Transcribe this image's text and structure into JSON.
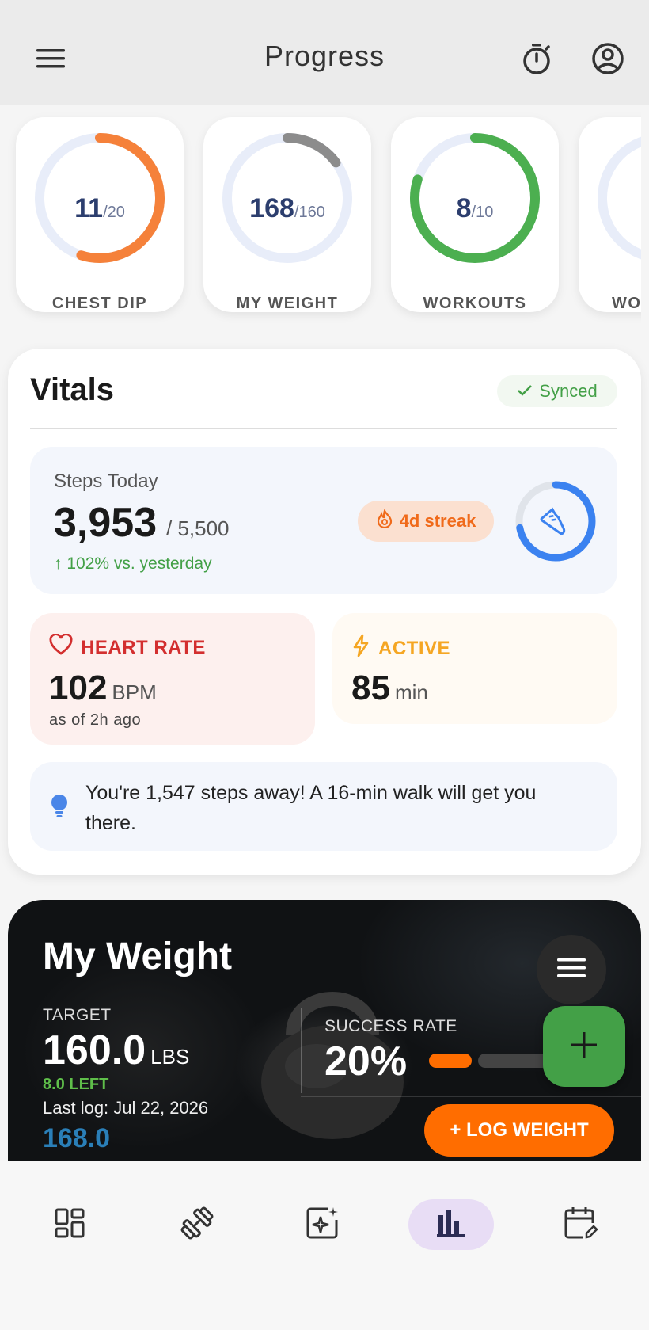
{
  "appbar": {
    "title": "Progress",
    "menu_icon": "hamburger-menu-icon",
    "timer_icon": "stopwatch-icon",
    "account_icon": "account-circle-icon"
  },
  "rings": [
    {
      "value": "11",
      "goal": "/20",
      "label": "CHEST DIP",
      "progress": 0.55,
      "color": "#f5813a"
    },
    {
      "value": "168",
      "goal": "/160",
      "label": "MY WEIGHT",
      "progress": 0.15,
      "color": "#8c8c8c"
    },
    {
      "value": "8",
      "goal": "/10",
      "label": "WORKOUTS",
      "progress": 0.8,
      "color": "#4caf50"
    },
    {
      "value": "",
      "goal": "",
      "label": "WO",
      "progress": 0,
      "color": "#e8edf9"
    }
  ],
  "vitals": {
    "title": "Vitals",
    "sync_status": "Synced",
    "steps": {
      "label": "Steps Today",
      "value": "3,953",
      "goal": "/ 5,500",
      "delta": "↑ 102% vs. yesterday",
      "streak": "4d streak",
      "progress": 0.72
    },
    "heart_rate": {
      "label": "HEART RATE",
      "value": "102",
      "unit": "BPM",
      "sub": "as of 2h ago"
    },
    "active": {
      "label": "ACTIVE",
      "value": "85",
      "unit": "min"
    },
    "tip": "You're 1,547 steps away! A 16-min walk will get you there."
  },
  "weight": {
    "title": "My Weight",
    "target_label": "TARGET",
    "target_value": "160.0",
    "target_unit": "LBS",
    "left": "8.0 LEFT",
    "last_log": "Last log: Jul 22, 2026",
    "current": "168.0",
    "success_label": "SUCCESS RATE",
    "success_value": "20%",
    "log_button": "+ LOG WEIGHT"
  },
  "colors": {
    "accent_orange": "#ff6d00",
    "accent_green": "#43a047",
    "ring_track": "#e8edf9",
    "nav_selected": "#e8ddf5"
  },
  "bottom_nav": [
    {
      "icon": "dashboard-icon",
      "selected": false
    },
    {
      "icon": "dumbbell-icon",
      "selected": false
    },
    {
      "icon": "ai-sparkle-icon",
      "selected": false
    },
    {
      "icon": "bar-chart-icon",
      "selected": true
    },
    {
      "icon": "calendar-edit-icon",
      "selected": false
    }
  ]
}
